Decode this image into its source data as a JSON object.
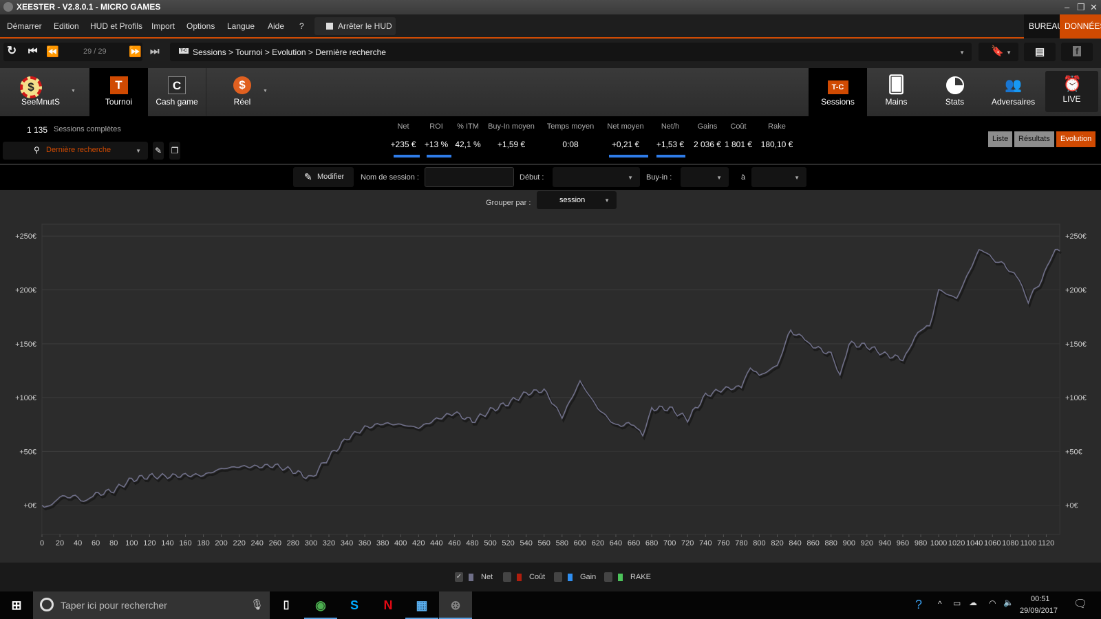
{
  "window": {
    "title": "XEESTER - V2.8.0.1 - MICRO GAMES"
  },
  "menu": {
    "items": [
      "Démarrer",
      "Edition",
      "HUD et Profils",
      "Import",
      "Options",
      "Langue",
      "Aide",
      "?"
    ],
    "hud_toggle": "Arrêter le HUD",
    "bureau": "BUREAU",
    "donnees": "DONNÉES"
  },
  "toolbar": {
    "pager": "29 / 29",
    "breadcrumb": "Sessions > Tournoi > Evolution > Dernière recherche",
    "crumb_icon_text": "T-C"
  },
  "nav": {
    "left": [
      {
        "label": "SeeMnutS"
      },
      {
        "label": "Tournoi",
        "glyph": "T"
      },
      {
        "label": "Cash game",
        "glyph": "C"
      },
      {
        "label": "Réel",
        "glyph": "$"
      }
    ],
    "right": [
      {
        "label": "Sessions",
        "glyph": "T-C"
      },
      {
        "label": "Mains"
      },
      {
        "label": "Stats"
      },
      {
        "label": "Adversaires"
      },
      {
        "label": "LIVE"
      }
    ]
  },
  "summary": {
    "count": "1 135",
    "count_label": "Sessions complètes",
    "search": "Dernière recherche"
  },
  "stats": [
    {
      "h": "Net",
      "v": "+235 €",
      "bar": true
    },
    {
      "h": "ROI",
      "v": "+13 %",
      "bar": true
    },
    {
      "h": "% ITM",
      "v": "42,1 %"
    },
    {
      "h": "Buy-In moyen",
      "v": "+1,59 €"
    },
    {
      "h": "Temps moyen",
      "v": "0:08"
    },
    {
      "h": "Net moyen",
      "v": "+0,21 €",
      "bar": true
    },
    {
      "h": "Net/h",
      "v": "+1,53 €",
      "bar": true
    },
    {
      "h": "Gains",
      "v": "2 036 €"
    },
    {
      "h": "Coût",
      "v": "1 801 €"
    },
    {
      "h": "Rake",
      "v": "180,10 €"
    }
  ],
  "views": [
    "Liste",
    "Résultats",
    "Evolution"
  ],
  "filters": {
    "modify": "Modifier",
    "session_name_label": "Nom de session :",
    "session_name_value": "",
    "start_label": "Début :",
    "buyin_label": "Buy-in :",
    "to_label": "à",
    "group_label": "Grouper par :",
    "group_value": "session"
  },
  "legend": [
    {
      "label": "Net",
      "color": "#6f6f88",
      "checked": true
    },
    {
      "label": "Coût",
      "color": "#b01e0e",
      "checked": false
    },
    {
      "label": "Gain",
      "color": "#2f8ef0",
      "checked": false
    },
    {
      "label": "RAKE",
      "color": "#4cc35a",
      "checked": false
    }
  ],
  "taskbar": {
    "search_placeholder": "Taper ici pour rechercher",
    "time": "00:51",
    "date": "29/09/2017"
  },
  "chart_data": {
    "type": "line",
    "xlabel": "",
    "ylabel": "",
    "xlim": [
      0,
      1135
    ],
    "ylim": [
      -27,
      261
    ],
    "yticks": [
      0,
      50,
      100,
      150,
      200,
      250
    ],
    "ytick_labels": [
      "+0€",
      "+50€",
      "+100€",
      "+150€",
      "+200€",
      "+250€"
    ],
    "xticks": [
      0,
      20,
      40,
      60,
      80,
      100,
      120,
      140,
      160,
      180,
      200,
      220,
      240,
      260,
      280,
      300,
      320,
      340,
      360,
      380,
      400,
      420,
      440,
      460,
      480,
      500,
      520,
      540,
      560,
      580,
      600,
      620,
      640,
      660,
      680,
      700,
      720,
      740,
      760,
      780,
      800,
      820,
      840,
      860,
      880,
      900,
      920,
      940,
      960,
      980,
      1000,
      1020,
      1040,
      1060,
      1080,
      1100,
      1120
    ],
    "grid": true,
    "series": [
      {
        "name": "Net",
        "color": "#6f6f88",
        "points": [
          [
            0,
            0
          ],
          [
            5,
            -3
          ],
          [
            20,
            8
          ],
          [
            40,
            8
          ],
          [
            50,
            4
          ],
          [
            60,
            10
          ],
          [
            80,
            14
          ],
          [
            100,
            24
          ],
          [
            120,
            27
          ],
          [
            140,
            27
          ],
          [
            160,
            28
          ],
          [
            180,
            28
          ],
          [
            200,
            34
          ],
          [
            220,
            36
          ],
          [
            240,
            36
          ],
          [
            260,
            37
          ],
          [
            280,
            32
          ],
          [
            300,
            25
          ],
          [
            320,
            45
          ],
          [
            340,
            62
          ],
          [
            360,
            72
          ],
          [
            380,
            76
          ],
          [
            400,
            75
          ],
          [
            420,
            72
          ],
          [
            440,
            80
          ],
          [
            460,
            86
          ],
          [
            480,
            78
          ],
          [
            500,
            88
          ],
          [
            520,
            95
          ],
          [
            540,
            104
          ],
          [
            560,
            107
          ],
          [
            580,
            82
          ],
          [
            600,
            115
          ],
          [
            620,
            90
          ],
          [
            640,
            74
          ],
          [
            660,
            76
          ],
          [
            670,
            63
          ],
          [
            680,
            90
          ],
          [
            700,
            90
          ],
          [
            720,
            80
          ],
          [
            740,
            102
          ],
          [
            760,
            108
          ],
          [
            780,
            110
          ],
          [
            790,
            130
          ],
          [
            800,
            120
          ],
          [
            820,
            130
          ],
          [
            835,
            163
          ],
          [
            860,
            148
          ],
          [
            880,
            140
          ],
          [
            890,
            122
          ],
          [
            900,
            150
          ],
          [
            920,
            148
          ],
          [
            940,
            140
          ],
          [
            960,
            136
          ],
          [
            970,
            150
          ],
          [
            980,
            162
          ],
          [
            990,
            168
          ],
          [
            1000,
            200
          ],
          [
            1020,
            192
          ],
          [
            1040,
            228
          ],
          [
            1045,
            238
          ],
          [
            1060,
            230
          ],
          [
            1070,
            225
          ],
          [
            1090,
            210
          ],
          [
            1100,
            190
          ],
          [
            1115,
            210
          ],
          [
            1130,
            238
          ],
          [
            1135,
            236
          ]
        ]
      }
    ]
  }
}
